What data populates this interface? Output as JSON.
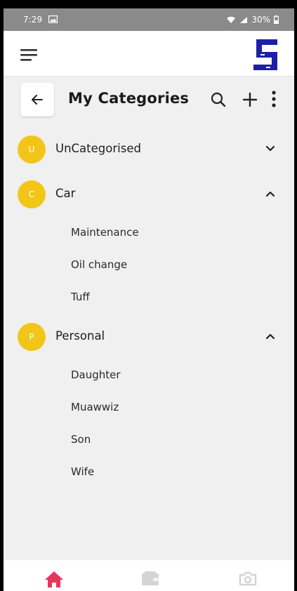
{
  "status_bar": {
    "time": "7:29",
    "battery": "30%"
  },
  "header": {
    "title": "My Categories"
  },
  "categories": [
    {
      "initial": "U",
      "name": "UnCategorised",
      "expanded": false,
      "subcategories": []
    },
    {
      "initial": "C",
      "name": "Car",
      "expanded": true,
      "subcategories": [
        "Maintenance",
        "Oil change",
        "Tuff"
      ]
    },
    {
      "initial": "P",
      "name": "Personal",
      "expanded": true,
      "subcategories": [
        "Daughter",
        "Muawwiz",
        "Son",
        "Wife"
      ]
    }
  ],
  "bottom_nav": [
    {
      "icon": "home-icon",
      "active": true
    },
    {
      "icon": "wallet-icon",
      "active": false
    },
    {
      "icon": "camera-icon",
      "active": false
    }
  ],
  "colors": {
    "avatar": "#f2c618",
    "logo": "#1d1fa8",
    "home_active": "#e8355a",
    "nav_inactive": "#d4d4d4"
  }
}
